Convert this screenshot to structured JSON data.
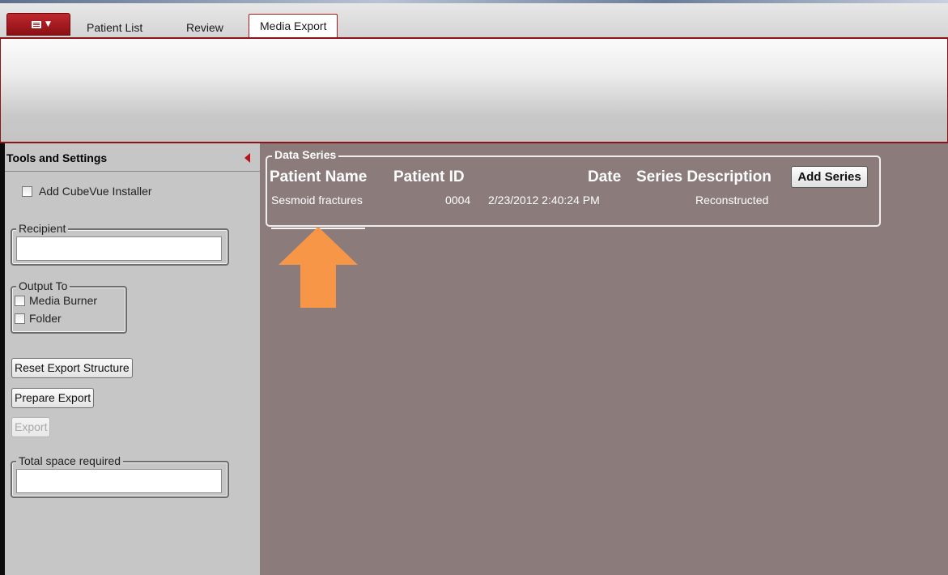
{
  "tabs": {
    "items": [
      "Patient List",
      "Review",
      "Media Export"
    ],
    "active": "Media Export"
  },
  "sidebar": {
    "title": "Tools and Settings",
    "add_installer_label": "Add CubeVue Installer",
    "recipient_legend": "Recipient",
    "recipient_value": "",
    "output_legend": "Output To",
    "output_media_burner": "Media Burner",
    "output_folder": "Folder",
    "reset_button": "Reset Export Structure",
    "prepare_button": "Prepare Export",
    "export_button": "Export",
    "space_legend": "Total space required",
    "space_value": ""
  },
  "data_series": {
    "legend": "Data Series",
    "columns": [
      "Patient Name",
      "Patient ID",
      "Date",
      "Series Description"
    ],
    "add_series_label": "Add Series",
    "rows": [
      {
        "patient_name": "Sesmoid fractures",
        "patient_id": "0004",
        "date": "2/23/2012 2:40:24 PM",
        "series_description": "Reconstructed"
      }
    ]
  },
  "colors": {
    "accent_red": "#8c1519",
    "main_bg": "#8b7b7b",
    "sidebar_bg": "#c6c6c6",
    "arrow_orange": "#f79646"
  },
  "icons": {
    "app_menu": "app-menu-icon",
    "collapse": "collapse-left-icon",
    "annotation": "up-arrow-icon"
  }
}
